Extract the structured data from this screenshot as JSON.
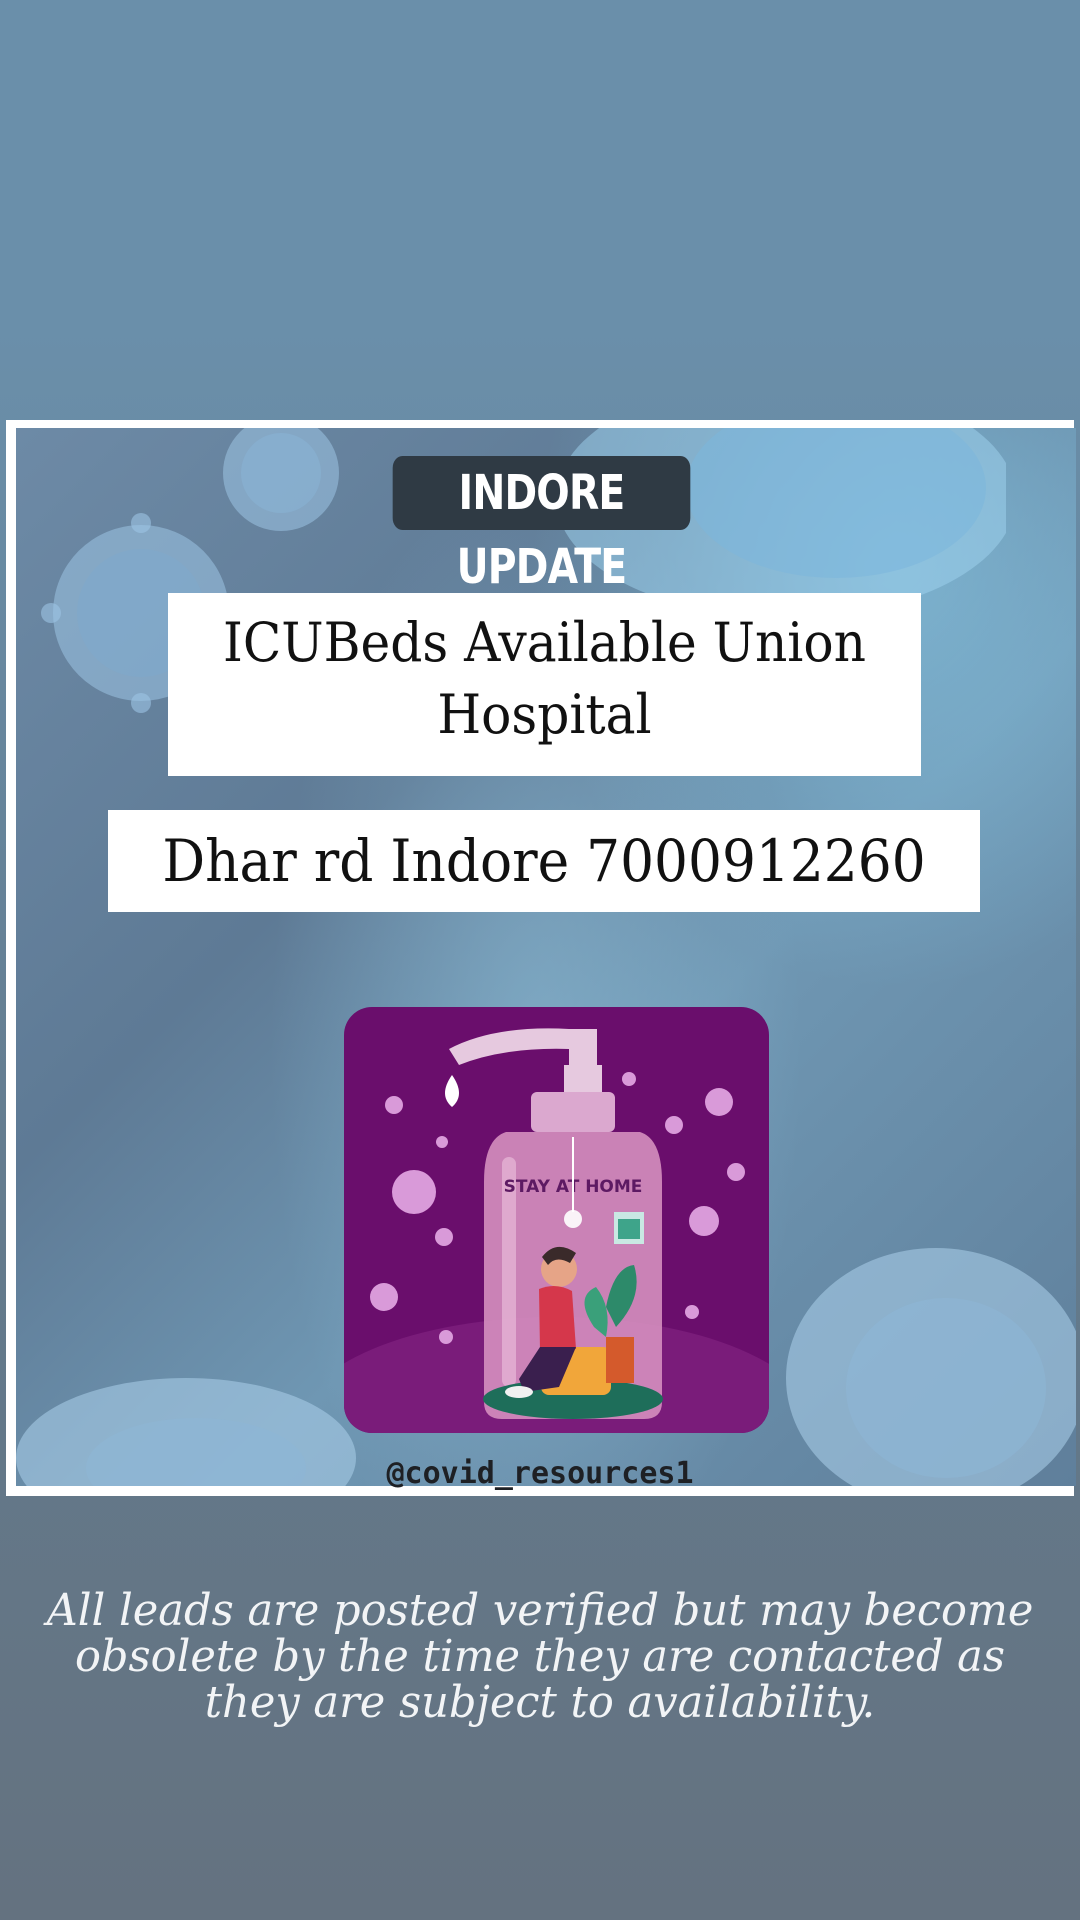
{
  "story": {
    "badge": "INDORE UPDATE",
    "headline": "ICUBeds Available Union Hospital",
    "address": "Dhar rd Indore 7000912260",
    "illustration": {
      "caption": "STAY AT HOME"
    },
    "handle": "@covid_resources1"
  },
  "disclaimer": "All leads are posted verified but may become obsolete by the time they are contacted as they are subject to availability.",
  "colors": {
    "top_background": "#6a8faa",
    "bottom_background": "#637a8c",
    "badge_background": "#2f3a44",
    "illustration_background": "#6a0e6c"
  }
}
